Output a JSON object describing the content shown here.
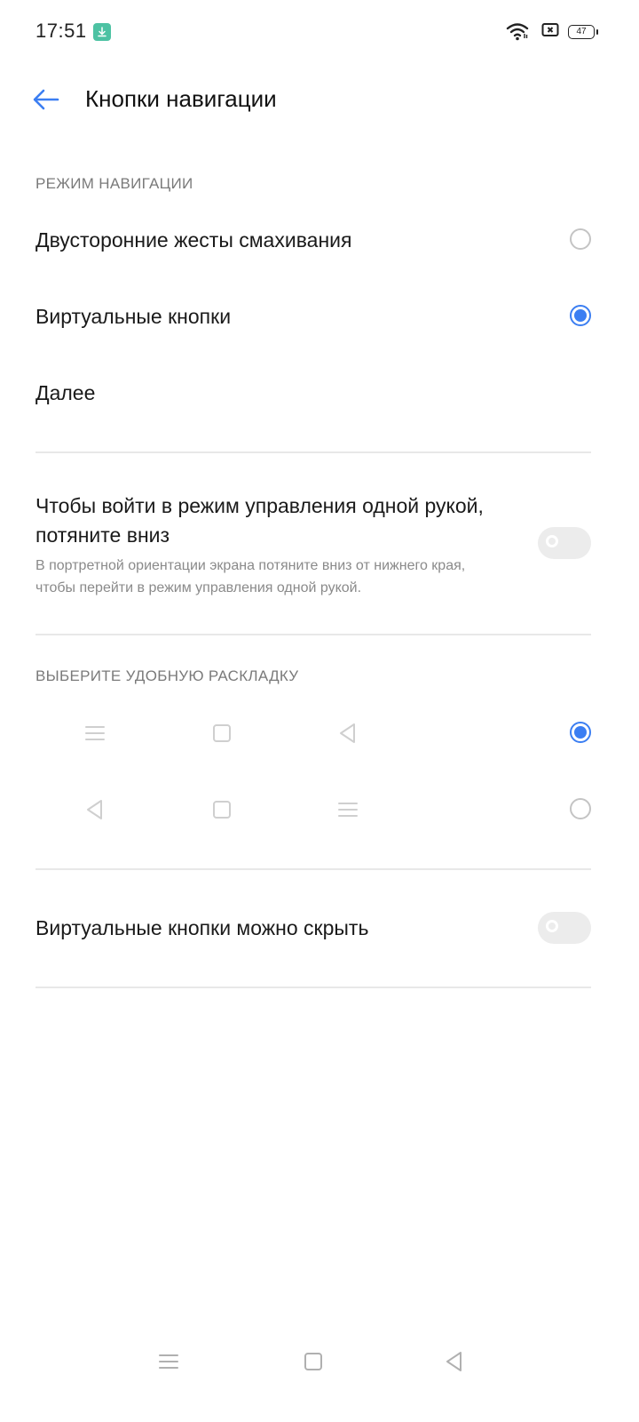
{
  "status_bar": {
    "time": "17:51",
    "battery": "47",
    "icons": [
      "download-icon",
      "wifi-icon",
      "notification-x-icon",
      "battery-icon"
    ]
  },
  "app_bar": {
    "title": "Кнопки навигации",
    "back_icon": "arrow-left-icon"
  },
  "nav_mode": {
    "header": "РЕЖИМ НАВИГАЦИИ",
    "options": [
      {
        "label": "Двусторонние жесты смахивания",
        "selected": false
      },
      {
        "label": "Виртуальные кнопки",
        "selected": true
      }
    ],
    "more_label": "Далее"
  },
  "one_hand": {
    "title": "Чтобы войти в режим управления одной рукой, потяните вниз",
    "subtitle": "В портретной ориентации экрана потяните вниз от нижнего края, чтобы перейти в режим управления одной рукой.",
    "enabled": false
  },
  "layout": {
    "header": "ВЫБЕРИТЕ УДОБНУЮ РАСКЛАДКУ",
    "options": [
      {
        "icons": [
          "menu-icon",
          "home-square-icon",
          "back-triangle-icon"
        ],
        "selected": true
      },
      {
        "icons": [
          "back-triangle-icon",
          "home-square-icon",
          "menu-icon"
        ],
        "selected": false
      }
    ]
  },
  "hide_buttons": {
    "label": "Виртуальные кнопки можно скрыть",
    "enabled": false
  },
  "system_nav": {
    "icons": [
      "menu-icon",
      "home-square-icon",
      "back-triangle-icon"
    ]
  },
  "colors": {
    "accent": "#3b7ef2",
    "download_badge": "#4dc2a3",
    "toggle_off": "#ececec",
    "divider": "#e8e8e8"
  }
}
